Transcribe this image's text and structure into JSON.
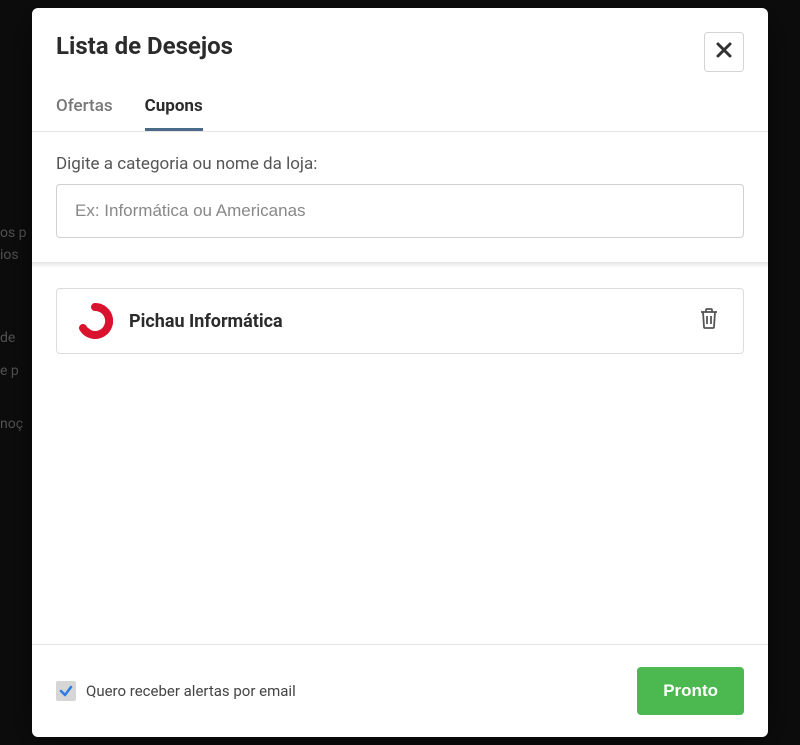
{
  "modal": {
    "title": "Lista de Desejos"
  },
  "tabs": [
    {
      "label": "Ofertas",
      "active": false
    },
    {
      "label": "Cupons",
      "active": true
    }
  ],
  "search": {
    "label": "Digite a categoria ou nome da loja:",
    "placeholder": "Ex: Informática ou Americanas",
    "value": ""
  },
  "items": [
    {
      "name": "Pichau Informática",
      "logo_color": "#d9122e"
    }
  ],
  "footer": {
    "alerts_checkbox_label": "Quero receber alertas por email",
    "alerts_checkbox_checked": true,
    "done_label": "Pronto"
  }
}
